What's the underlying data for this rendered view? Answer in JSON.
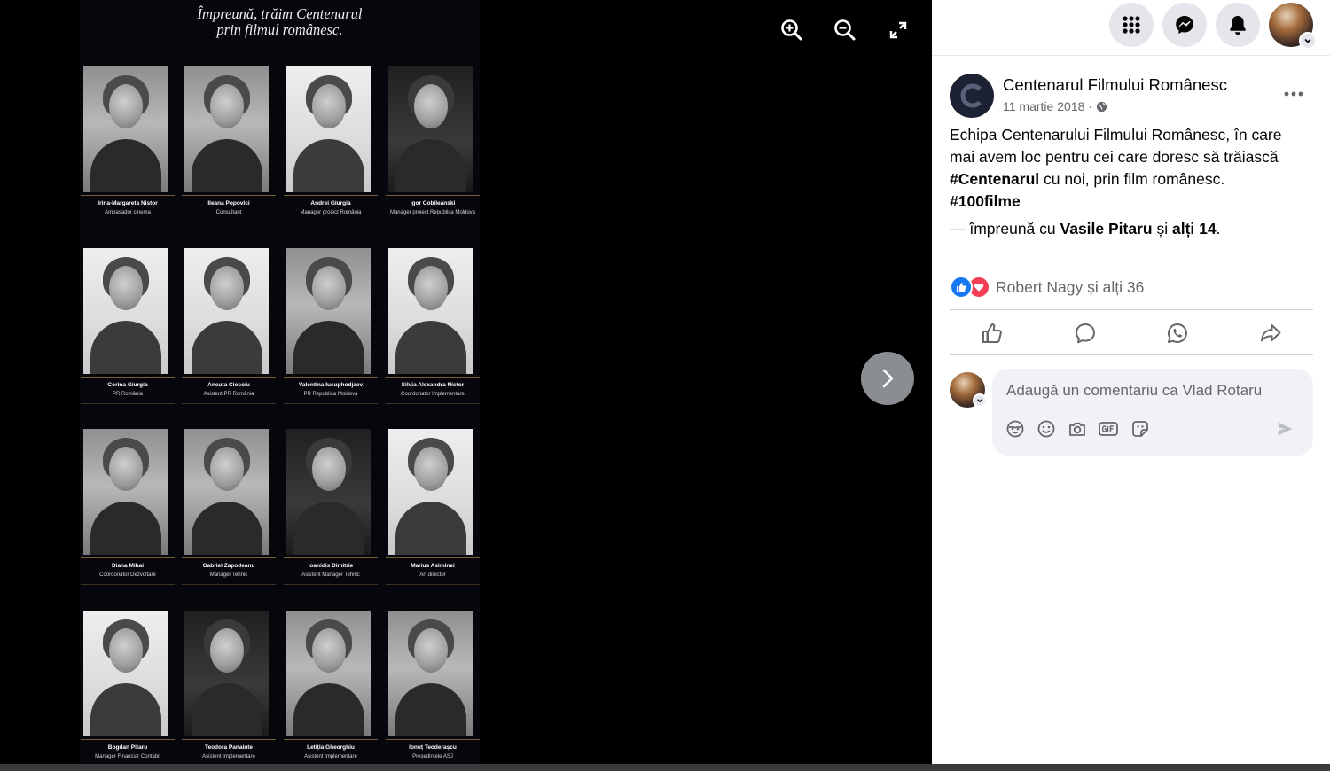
{
  "poster": {
    "title_line1": "Împreună, trăim Centenarul",
    "title_line2": "prin filmul românesc.",
    "people": [
      {
        "name": "Irina-Margareta Nistor",
        "role": "Ambasador cinema",
        "tone": "mid"
      },
      {
        "name": "Ileana Popovici",
        "role": "Consultant",
        "tone": "mid"
      },
      {
        "name": "Andrei Giurgia",
        "role": "Manager proiect România",
        "tone": "light"
      },
      {
        "name": "Igor Cobileanski",
        "role": "Manager proiect Republica Moldova",
        "tone": "dark"
      },
      {
        "name": "Corina Giurgia",
        "role": "PR România",
        "tone": "light"
      },
      {
        "name": "Ancuța Ciocoiu",
        "role": "Asistent PR România",
        "tone": "light"
      },
      {
        "name": "Valentina Iusuphodjaev",
        "role": "PR Republica Moldova",
        "tone": "mid"
      },
      {
        "name": "Silvia Alexandra Nistor",
        "role": "Coordonator Implementare",
        "tone": "light"
      },
      {
        "name": "Diana Mihai",
        "role": "Coordonator Dezvoltare",
        "tone": "mid"
      },
      {
        "name": "Gabriel Zapodeanu",
        "role": "Manager Tehnic",
        "tone": "mid"
      },
      {
        "name": "Ioanidis Dimitrie",
        "role": "Asistent Manager Tehnic",
        "tone": "dark"
      },
      {
        "name": "Marius Asiminei",
        "role": "Art director",
        "tone": "light"
      },
      {
        "name": "Bogdan Pitaru",
        "role": "Manager Financiar Contabil",
        "tone": "light"
      },
      {
        "name": "Teodora Panainte",
        "role": "Asistent Implementare",
        "tone": "dark"
      },
      {
        "name": "Letiția Gheorghiu",
        "role": "Asistent Implementare",
        "tone": "mid"
      },
      {
        "name": "Ionuț Teoderașcu",
        "role": "Președintele ASJ",
        "tone": "mid"
      }
    ]
  },
  "viewer": {
    "icons": [
      "zoom-in-icon",
      "zoom-out-icon",
      "fullscreen-icon",
      "next-arrow-icon"
    ]
  },
  "topbar": {
    "icons": [
      "menu-grid-icon",
      "messenger-icon",
      "bell-icon",
      "account-avatar"
    ]
  },
  "post": {
    "page_name": "Centenarul Filmului Românesc",
    "date": "11 martie 2018",
    "date_separator": " · ",
    "text_plain": "Echipa Centenarului Filmului Românesc, în care mai avem loc pentru cei care doresc să trăiască ",
    "hashtag1": "#Centenarul",
    "text_after": " cu noi, prin film românesc.",
    "hashtag2": "#100filme",
    "with_prefix": "— împreună cu ",
    "with_person": "Vasile Pitaru",
    "with_mid": " și ",
    "with_others": "alți 14",
    "with_suffix": ".",
    "reactions_text": "Robert Nagy și alți 36",
    "actions": [
      "like-action",
      "comment-action",
      "whatsapp-action",
      "share-action"
    ]
  },
  "comment": {
    "placeholder": "Adaugă un comentariu ca Vlad Rotaru",
    "tools": [
      "avatar-sticker-icon",
      "emoji-icon",
      "camera-icon",
      "gif-icon",
      "sticker-icon"
    ]
  },
  "colors": {
    "accent": "#1877f2",
    "love": "#f33e58",
    "muted": "#65676b",
    "poster_bg": "#06070d"
  }
}
